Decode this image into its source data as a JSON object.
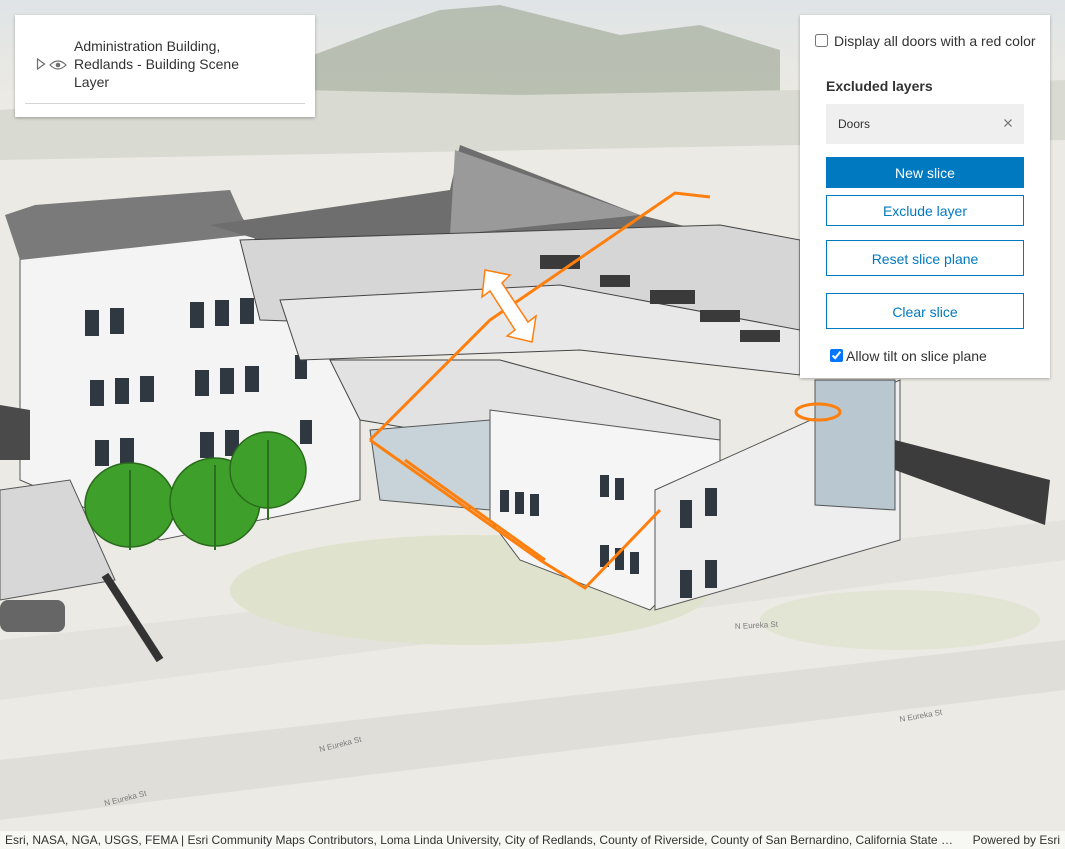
{
  "layer_list": {
    "title": "Administration Building, Redlands - Building Scene Layer",
    "toggle_icon": "caret-right-icon",
    "visibility_icon": "eye-icon"
  },
  "slice_panel": {
    "display_doors_label": "Display all doors with a red color",
    "display_doors_checked": false,
    "excluded_layers_title": "Excluded layers",
    "excluded_layers": [
      {
        "label": "Doors",
        "remove_icon": "close-icon"
      }
    ],
    "new_slice_label": "New slice",
    "exclude_layer_label": "Exclude layer",
    "reset_slice_label": "Reset slice plane",
    "clear_slice_label": "Clear slice",
    "allow_tilt_label": "Allow tilt on slice plane",
    "allow_tilt_checked": true
  },
  "map": {
    "street_labels": [
      "N Eureka St",
      "N Eureka St",
      "N Eureka St",
      "N Eureka St"
    ],
    "slice_color": "#ff7f0e"
  },
  "attribution": {
    "text": "Esri, NASA, NGA, USGS, FEMA | Esri Community Maps Contributors, Loma Linda University, City of Redlands, County of Riverside, County of San Bernardino, California State Pa…",
    "powered_by": "Powered by Esri"
  },
  "colors": {
    "accent": "#0079c1",
    "panel_bg": "#ffffff",
    "chip_bg": "#efefef"
  }
}
